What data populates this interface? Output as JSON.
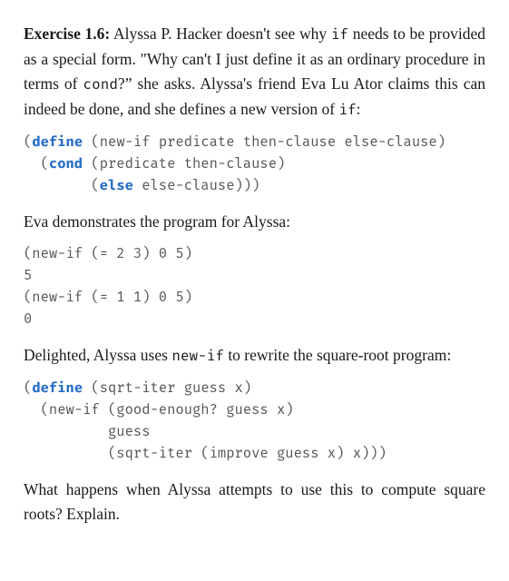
{
  "exercise": {
    "label": "Exercise 1.6:",
    "intro_pre": " Alyssa P. Hacker doesn't see why ",
    "intro_code1": "if",
    "intro_mid1": " needs to be provided as a special form. \"Why can't I just define it as an ordinary procedure in terms of ",
    "intro_code2": "cond",
    "intro_mid2": "?” she asks. Alyssa's friend Eva Lu Ator claims this can indeed be done, and she defines a new version of ",
    "intro_code3": "if",
    "intro_tail": ":"
  },
  "code1": {
    "l1a": "(",
    "l1kw": "define",
    "l1b": " (new-if predicate then-clause else-clause)",
    "l2a": "  (",
    "l2kw": "cond",
    "l2b": " (predicate then-clause)",
    "l3a": "        (",
    "l3kw": "else",
    "l3b": " else-clause)))"
  },
  "para2": "Eva demonstrates the program for Alyssa:",
  "code2": {
    "l1": "(new-if (= 2 3) 0 5)",
    "l2": "5",
    "l3": "(new-if (= 1 1) 0 5)",
    "l4": "0"
  },
  "para3": {
    "pre": "Delighted, Alyssa uses ",
    "code": "new-if",
    "post": " to rewrite the square-root program:"
  },
  "code3": {
    "l1a": "(",
    "l1kw": "define",
    "l1b": " (sqrt-iter guess x)",
    "l2": "  (new-if (good-enough? guess x)",
    "l3": "          guess",
    "l4": "          (sqrt-iter (improve guess x) x)))"
  },
  "para4": "What happens when Alyssa attempts to use this to compute square roots? Explain."
}
